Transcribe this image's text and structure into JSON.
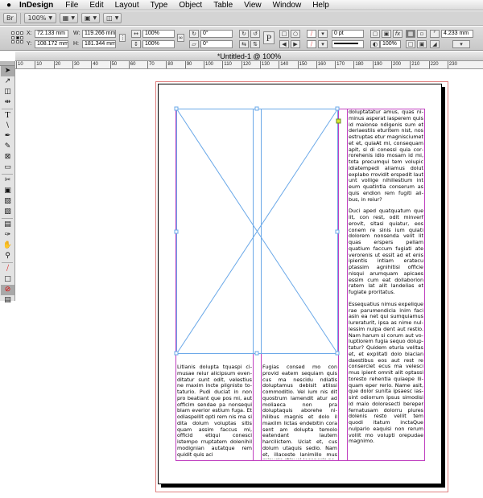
{
  "menubar": {
    "app_name": "InDesign",
    "menus": [
      "File",
      "Edit",
      "Layout",
      "Type",
      "Object",
      "Table",
      "View",
      "Window",
      "Help"
    ]
  },
  "appbar": {
    "bridge_label": "Br",
    "zoom_value": "100%"
  },
  "control": {
    "x_label": "X:",
    "x_value": "72.133 mm",
    "y_label": "Y:",
    "y_value": "108.172 mm",
    "w_label": "W:",
    "w_value": "119.266 mm",
    "h_label": "H:",
    "h_value": "181.344 mm",
    "scale_x": "100%",
    "scale_y": "100%",
    "rotation": "0°",
    "shear": "0°",
    "stroke_weight": "0 pt",
    "opacity": "100%",
    "fitting_value": "4.233 mm",
    "pi_label": "P"
  },
  "document": {
    "tab_title": "*Untitled-1 @ 100%",
    "ruler_marks": [
      "10",
      "10",
      "20",
      "30",
      "40",
      "50",
      "60",
      "70",
      "80",
      "90",
      "100",
      "110",
      "120",
      "130",
      "140",
      "150",
      "160",
      "170",
      "180",
      "190",
      "200",
      "210",
      "220",
      "230"
    ]
  },
  "text": {
    "col1": "Litianis dolupta tquaspi ci­musae reiur alicipsum even­ditatur sunt odit, velestius ne maxim incte plignisto to­taturio. Pudi duciat in non pro beatiant que pos mi, aut officim sendae pa nonsequi blam everior estium fuga. Et odiaspellit opti rem nis ma si dita dolum voluptas sitis quam assim faccus mi, officid etiqui conesci istempo rrup­tatem dolenihil modignian autatque rem quidit quis aci",
    "col2": "Fugias consed mo con provid eatem sequiam quis cus ma nescidu ndiatis doluptamus debisit atiissi commoditio. Vel ium nis dit quostrum la­mendit atur ad moliaeca non pra doluptaquis aborehe ni­hilibus magnis et dolo il max­ilm lictas endebitin cora sent am dolupta temolo eatendant lautem harcilictem. Uciat et, cus dolum utaquis sedio. Nam et, illaceste lanimillo mus minvele stinvel leceperis pa",
    "col3_p1": "doluptatatur amus, quas ni­minus asperat iasperem quis id maionse ndigenis sum et deriaestiis eturitem nist, nos estruptas etur magnisciumet et et, quiaAt mi, consequam apit, si di conessi quia cor­rorehenis idio mosam id mi, tota precumqui tem volupic idiatempedi aliamus dolut explabo rrovidit erspedit laut unt vollige nihillestium int eum quatintia conserum as quis endion rem fugiti ali­bus, in reiur?",
    "col3_p2": "Duci aped quatquatum que lit, con rest, odit minverf ero­vit, sitasi quiatur, eos conem re sinis ium quiati dolorem nonsenda velit lit quas er­spers pellam quatium faccum fugiati ate verorenis ut essit ad et enis ipientis intiam er­atecu ptassim agnihitisi offi­cie nisqui arumquam apicaes essim cum eat dollaborion ratem lat alit landelias et fugiate proritatus.",
    "col3_p3": "Essequatius nimus expelique rae parumendicia inim faci asin ea net qui sumquiamus lureraturit, ipsa as nime nul­lessim nulpa dent aut restio. Nam harum si corum aut vo­luptiorem fugia sequo dolup­tatur? Quidem eturia velitas et, et explitati dolo biacian daestibus eos aut rest re conserclet ecus ma velesci mus ipient omnit alit optassi toresto rehentia quiaepe lli­quam eper rerio. Name asit, que dolor sunita ipsaesc ias­sint odiorrum ipsus simodisi id maio doloresecti bereper fernatusam dolorru plures dolenis resto vellit tem quodi itatum inctaQue nulpario ea­quisi non rerum vollit mo vo­lupti orepudae magnimo."
  },
  "colors": {
    "frame_blue": "#6aa8e8",
    "column_guide": "#c040c0",
    "bleed_red": "#e08080"
  },
  "tool_icons": [
    "selection-tool-icon",
    "direct-selection-tool-icon",
    "page-tool-icon",
    "gap-tool-icon",
    "type-tool-icon",
    "line-tool-icon",
    "pen-tool-icon",
    "pencil-tool-icon",
    "rectangle-frame-tool-icon",
    "rectangle-tool-icon",
    "scissors-tool-icon",
    "free-transform-tool-icon",
    "gradient-swatch-tool-icon",
    "gradient-feather-tool-icon",
    "note-tool-icon",
    "eyedropper-tool-icon",
    "hand-tool-icon",
    "zoom-tool-icon"
  ]
}
